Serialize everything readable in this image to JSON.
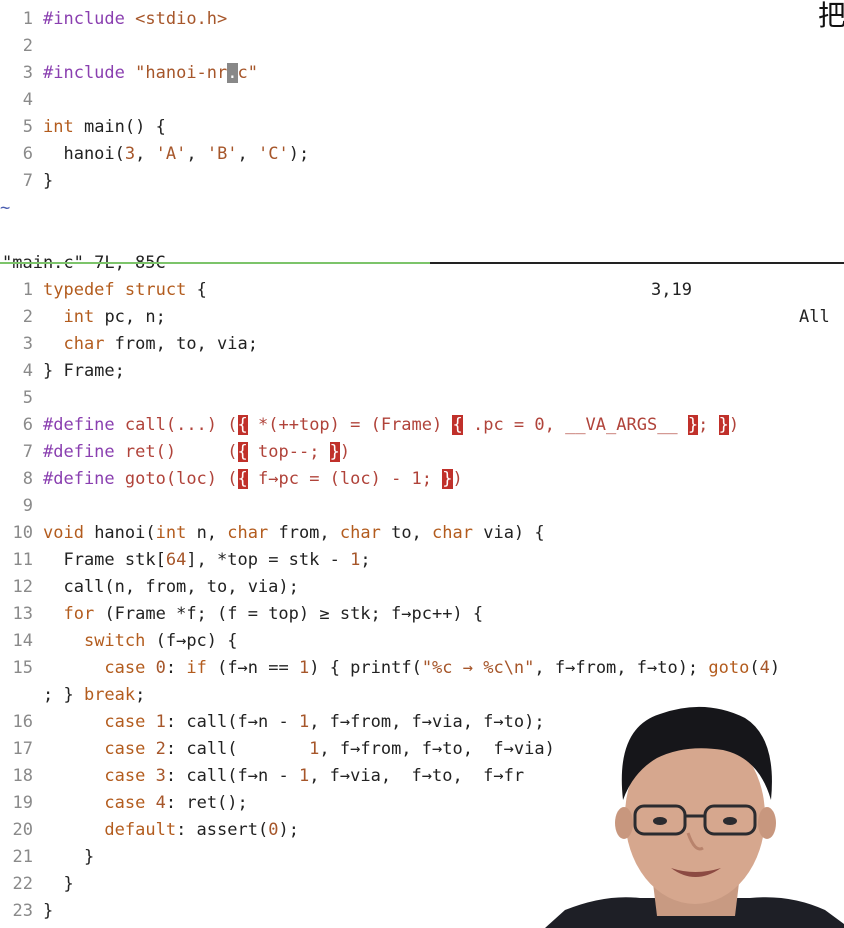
{
  "top_editor": {
    "lines": [
      {
        "n": "1",
        "text": "#include <stdio.h>"
      },
      {
        "n": "2",
        "text": ""
      },
      {
        "n": "3",
        "text": "#include \"hanoi-nr.c\""
      },
      {
        "n": "4",
        "text": ""
      },
      {
        "n": "5",
        "text": "int main() {"
      },
      {
        "n": "6",
        "text": "  hanoi(3, 'A', 'B', 'C');"
      },
      {
        "n": "7",
        "text": "}"
      }
    ],
    "empty_marker": "~",
    "status": {
      "file": "\"main.c\" 7L, 85C",
      "position": "3,19",
      "scroll": "All"
    }
  },
  "bottom_editor": {
    "lines": [
      {
        "n": "1",
        "text": "typedef struct {"
      },
      {
        "n": "2",
        "text": "  int pc, n;"
      },
      {
        "n": "3",
        "text": "  char from, to, via;"
      },
      {
        "n": "4",
        "text": "} Frame;"
      },
      {
        "n": "5",
        "text": ""
      },
      {
        "n": "6",
        "text": "#define call(...) ({ *(++top) = (Frame) { .pc = 0, __VA_ARGS__ }; })"
      },
      {
        "n": "7",
        "text": "#define ret()     ({ top--; })"
      },
      {
        "n": "8",
        "text": "#define goto(loc) ({ f→pc = (loc) - 1; })"
      },
      {
        "n": "9",
        "text": ""
      },
      {
        "n": "10",
        "text": "void hanoi(int n, char from, char to, char via) {"
      },
      {
        "n": "11",
        "text": "  Frame stk[64], *top = stk - 1;"
      },
      {
        "n": "12",
        "text": "  call(n, from, to, via);"
      },
      {
        "n": "13",
        "text": "  for (Frame *f; (f = top) ≥ stk; f→pc++) {"
      },
      {
        "n": "14",
        "text": "    switch (f→pc) {"
      },
      {
        "n": "15",
        "text": "      case 0: if (f→n == 1) { printf(\"%c → %c\\n\", f→from, f→to); goto(4)"
      },
      {
        "n": "",
        "text": "; } break;"
      },
      {
        "n": "16",
        "text": "      case 1: call(f→n - 1, f→from, f→via, f→to);"
      },
      {
        "n": "17",
        "text": "      case 2: call(       1, f→from, f→to,  f→via)"
      },
      {
        "n": "18",
        "text": "      case 3: call(f→n - 1, f→via,  f→to,  f→fr"
      },
      {
        "n": "19",
        "text": "      case 4: ret();"
      },
      {
        "n": "20",
        "text": "      default: assert(0);"
      },
      {
        "n": "21",
        "text": "    }"
      },
      {
        "n": "22",
        "text": "  }"
      },
      {
        "n": "23",
        "text": "}"
      }
    ]
  },
  "corner_glyph": "把",
  "colors": {
    "keyword": "#b35c1e",
    "preprocessor": "#8a3fb0",
    "bracket_highlight": "#c0302a",
    "split_active": "#7cc46a"
  }
}
